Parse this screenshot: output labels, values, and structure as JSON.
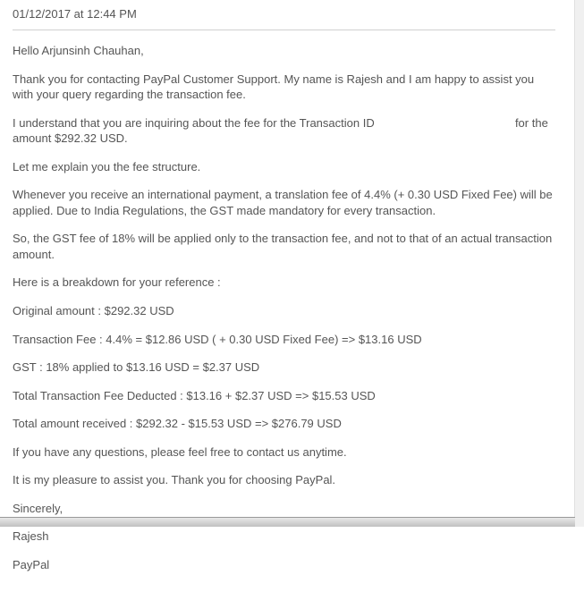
{
  "email": {
    "timestamp": "01/12/2017 at 12:44 PM",
    "greeting": "Hello Arjunsinh Chauhan,",
    "para1": "Thank you for contacting PayPal Customer Support. My name is Rajesh and I am happy to assist you with your query regarding the transaction fee.",
    "para2_pre": "I understand that you are inquiring about the fee for the Transaction ID ",
    "para2_post": " for the amount $292.32 USD.",
    "para3": "Let me explain you the fee structure.",
    "para4": "Whenever you receive an international payment, a translation fee of 4.4% (+ 0.30 USD Fixed Fee) will be applied. Due to India Regulations, the GST made mandatory for every transaction.",
    "para5": "So, the GST fee of 18% will be applied only to the transaction fee, and not to that of an actual transaction amount.",
    "para6": "Here is a breakdown for your reference :",
    "para7": "Original amount : $292.32 USD",
    "para8": "Transaction Fee : 4.4% = $12.86 USD ( + 0.30 USD Fixed Fee) => $13.16 USD",
    "para9": "GST : 18% applied to $13.16 USD = $2.37 USD",
    "para10": "Total Transaction Fee Deducted : $13.16 + $2.37 USD => $15.53 USD",
    "para11": "Total amount received  : $292.32 - $15.53 USD => $276.79 USD",
    "para12": "If you have any questions, please feel free to contact us anytime.",
    "para13": "It is my pleasure to assist you. Thank you for choosing PayPal.",
    "sig1": "Sincerely,",
    "sig2": "Rajesh",
    "sig3": "PayPal"
  }
}
